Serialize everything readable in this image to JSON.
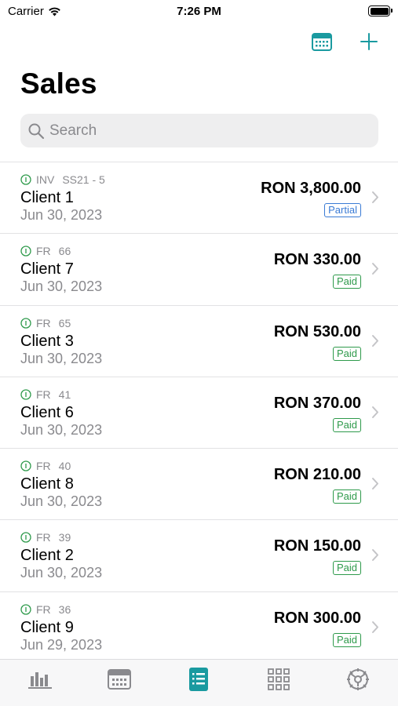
{
  "status_bar": {
    "carrier": "Carrier",
    "time": "7:26 PM",
    "battery_level": 1.0
  },
  "colors": {
    "accent": "#1a9aa0",
    "paid": "#2e9a4b",
    "partial": "#3a7bd5",
    "secondary_text": "#8a8a8e"
  },
  "nav": {
    "calendar_icon": "calendar-icon",
    "add_icon": "plus-icon"
  },
  "page": {
    "title": "Sales"
  },
  "search": {
    "placeholder": "Search",
    "value": ""
  },
  "sales": [
    {
      "doc_type": "INV",
      "doc_number": "SS21 - 5",
      "client": "Client 1",
      "date": "Jun 30, 2023",
      "amount": "RON 3,800.00",
      "status": "Partial"
    },
    {
      "doc_type": "FR",
      "doc_number": "66",
      "client": "Client 7",
      "date": "Jun 30, 2023",
      "amount": "RON 330.00",
      "status": "Paid"
    },
    {
      "doc_type": "FR",
      "doc_number": "65",
      "client": "Client 3",
      "date": "Jun 30, 2023",
      "amount": "RON 530.00",
      "status": "Paid"
    },
    {
      "doc_type": "FR",
      "doc_number": "41",
      "client": "Client 6",
      "date": "Jun 30, 2023",
      "amount": "RON 370.00",
      "status": "Paid"
    },
    {
      "doc_type": "FR",
      "doc_number": "40",
      "client": "Client 8",
      "date": "Jun 30, 2023",
      "amount": "RON 210.00",
      "status": "Paid"
    },
    {
      "doc_type": "FR",
      "doc_number": "39",
      "client": "Client 2",
      "date": "Jun 30, 2023",
      "amount": "RON 150.00",
      "status": "Paid"
    },
    {
      "doc_type": "FR",
      "doc_number": "36",
      "client": "Client 9",
      "date": "Jun 29, 2023",
      "amount": "RON 300.00",
      "status": "Paid"
    }
  ],
  "tab_bar": {
    "items": [
      {
        "icon": "bar-chart-icon",
        "active": false
      },
      {
        "icon": "calendar-icon",
        "active": false
      },
      {
        "icon": "list-icon",
        "active": true
      },
      {
        "icon": "grid-icon",
        "active": false
      },
      {
        "icon": "settings-icon",
        "active": false
      }
    ]
  }
}
